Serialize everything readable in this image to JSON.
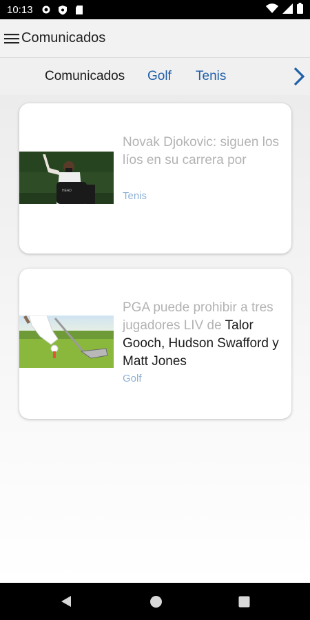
{
  "status_bar": {
    "time": "10:13",
    "icons": [
      "settings-icon",
      "shield-icon",
      "sd-card-icon",
      "wifi-icon",
      "signal-icon",
      "battery-icon"
    ]
  },
  "app_bar": {
    "title": "Comunicados",
    "menu_icon": "hamburger-menu-icon"
  },
  "tabs": [
    {
      "label": "Comunicados",
      "active": true
    },
    {
      "label": "Golf",
      "active": false
    },
    {
      "label": "Tenis",
      "active": false
    }
  ],
  "tabs_next_icon": "chevron-right-icon",
  "articles": [
    {
      "headline": "Novak Djokovic: siguen los líos en su carrera por",
      "category": "Tenis",
      "image": "tennis-player-photo"
    },
    {
      "headline_grey": "PGA puede prohibir a tres jugadores LIV de",
      "headline_dark": "Talor Gooch, Hudson Swafford y Matt Jones",
      "category": "Golf",
      "image": "golf-club-ball-photo"
    }
  ],
  "nav_bar": {
    "icons": [
      "back-icon",
      "home-icon",
      "recents-icon"
    ]
  },
  "colors": {
    "link_blue": "#1f5fa8",
    "category_blue": "#8fb2d6",
    "headline_grey": "#b3b3b3"
  }
}
